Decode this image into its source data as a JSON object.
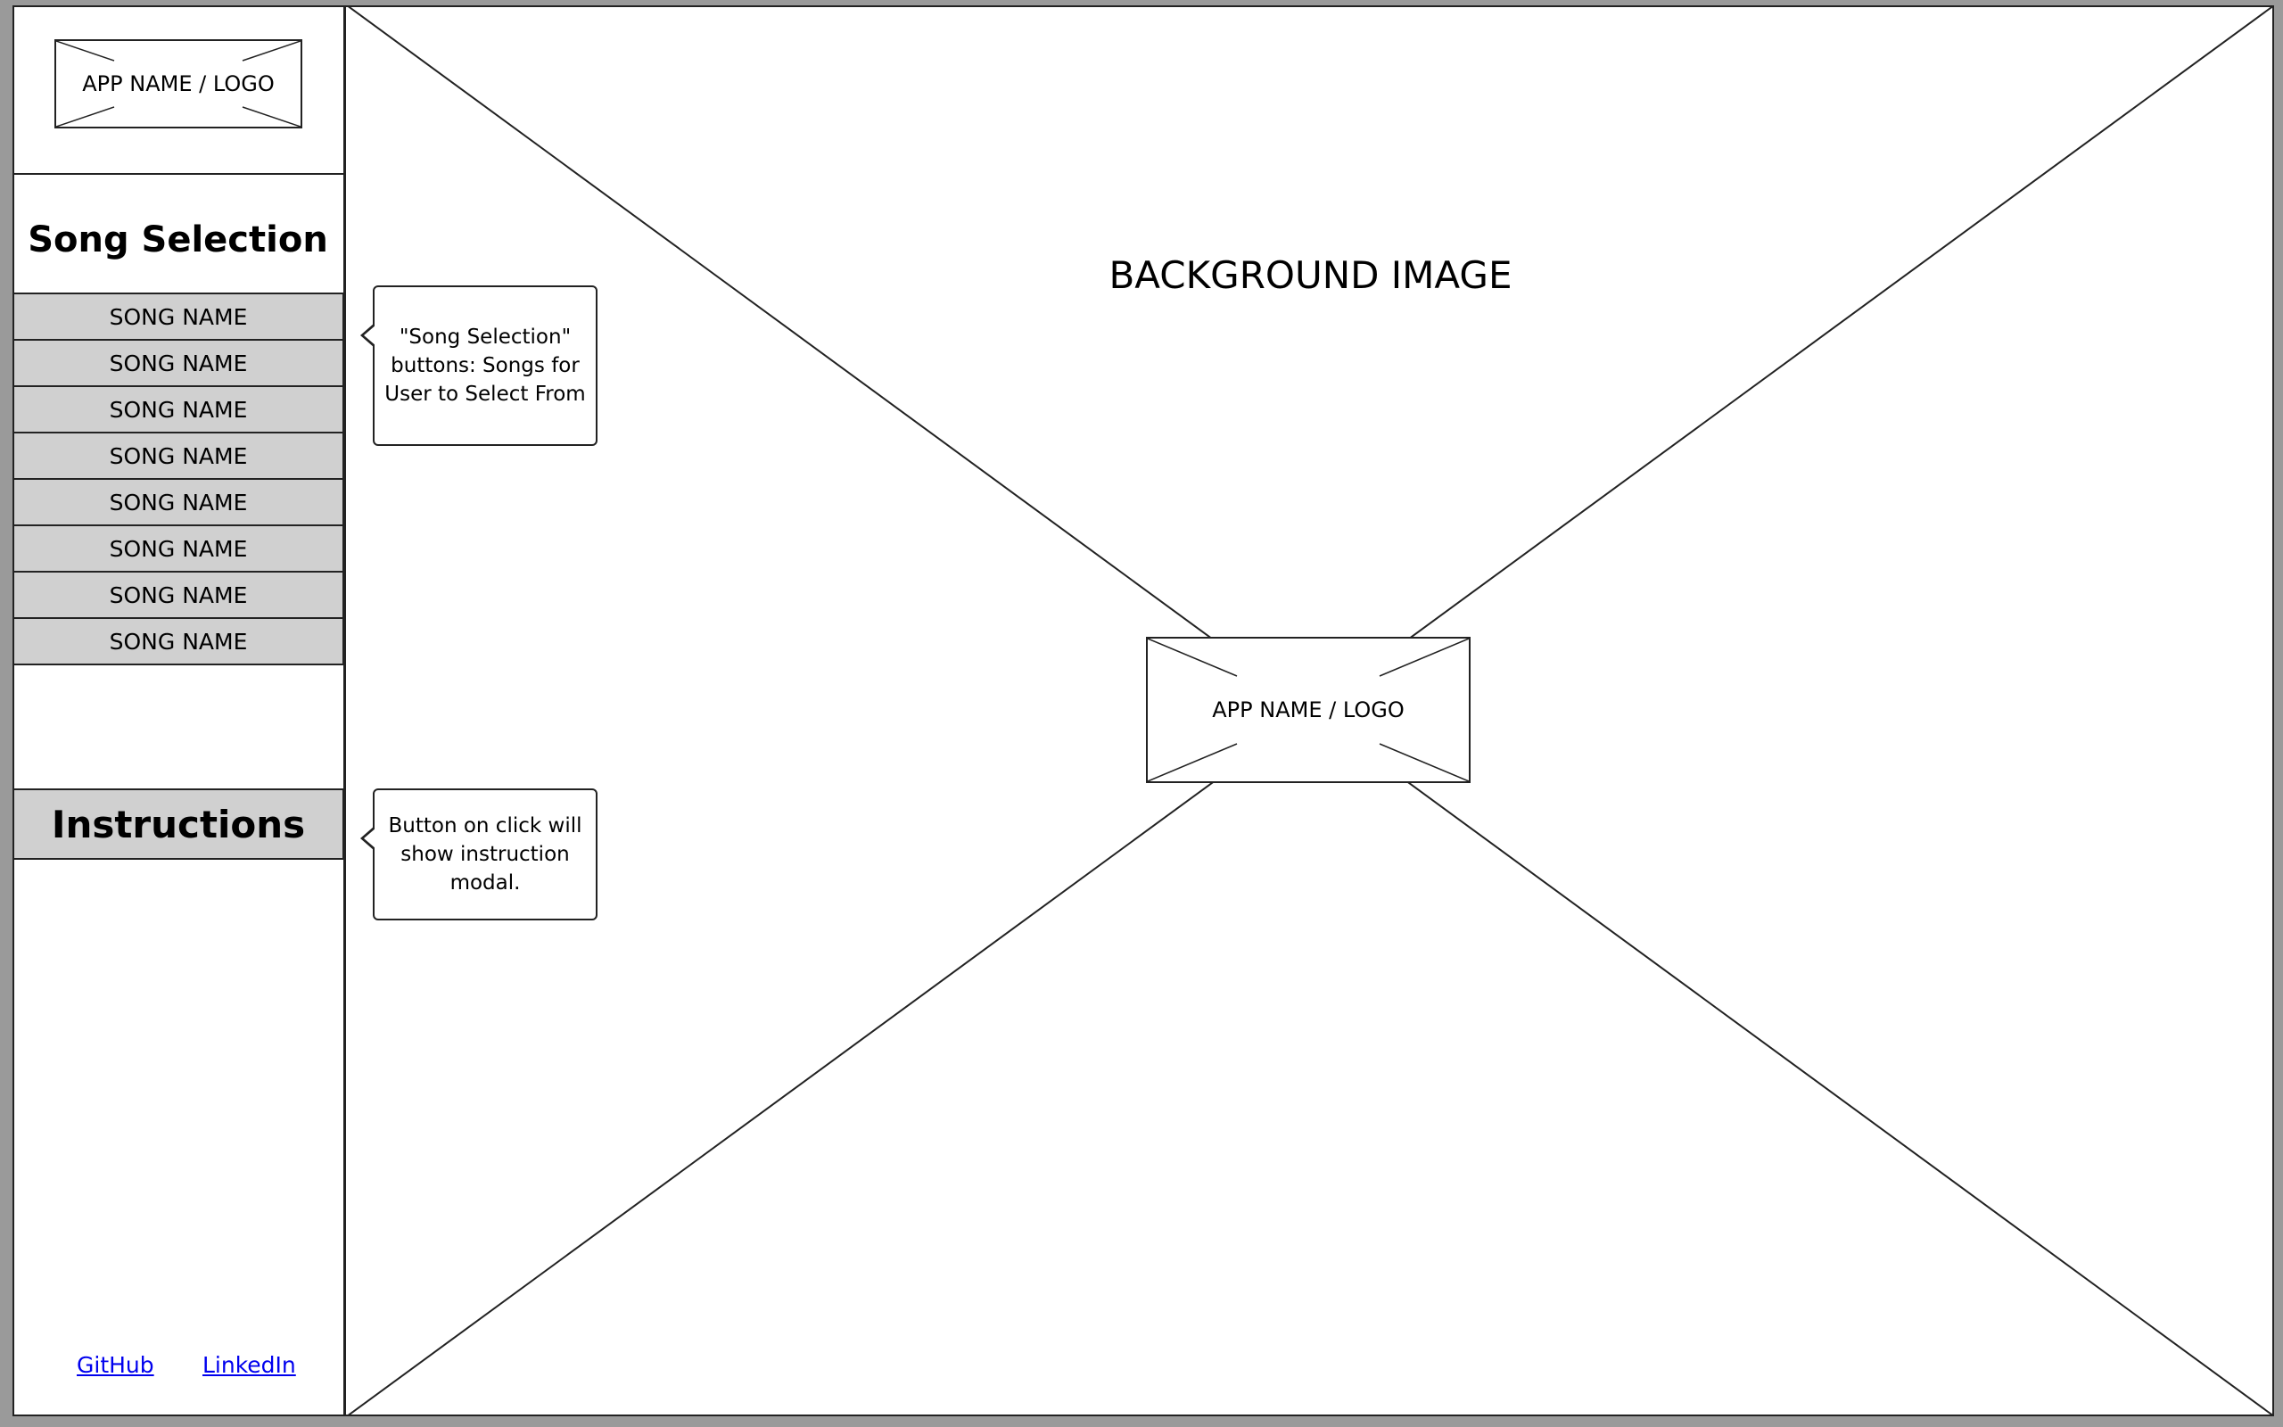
{
  "sidebar": {
    "logo": "APP NAME / LOGO",
    "song_section_title": "Song Selection",
    "songs": [
      "SONG NAME",
      "SONG NAME",
      "SONG NAME",
      "SONG NAME",
      "SONG NAME",
      "SONG NAME",
      "SONG NAME",
      "SONG NAME"
    ],
    "instructions_label": "Instructions",
    "footer": {
      "github": "GitHub",
      "linkedin": "LinkedIn"
    }
  },
  "annotations": {
    "song_selection_note": "\"Song Selection\" buttons: Songs for User to Select From",
    "instructions_note": "Button on click will show instruction modal."
  },
  "main": {
    "background_label": "BACKGROUND IMAGE",
    "center_logo": "APP NAME / LOGO"
  },
  "colors": {
    "button_fill": "#d0d0d0",
    "link": "#0000ee",
    "outer_background": "#9a9a9a"
  }
}
